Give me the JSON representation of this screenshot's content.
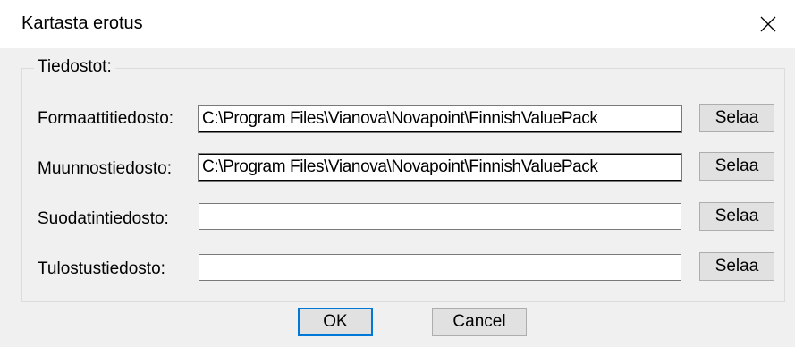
{
  "window": {
    "title": "Kartasta erotus"
  },
  "group": {
    "legend": "Tiedostot:"
  },
  "rows": [
    {
      "label": "Formaattitiedosto:",
      "value": "C:\\Program Files\\Vianova\\Novapoint\\FinnishValuePack",
      "button": "Selaa"
    },
    {
      "label": "Muunnostiedosto:",
      "value": "C:\\Program Files\\Vianova\\Novapoint\\FinnishValuePack",
      "button": "Selaa"
    },
    {
      "label": "Suodatintiedosto:",
      "value": "",
      "button": "Selaa"
    },
    {
      "label": "Tulostustiedosto:",
      "value": "",
      "button": "Selaa"
    }
  ],
  "footer": {
    "ok_label": "OK",
    "cancel_label": "Cancel"
  },
  "icons": {
    "close": "close-icon"
  }
}
